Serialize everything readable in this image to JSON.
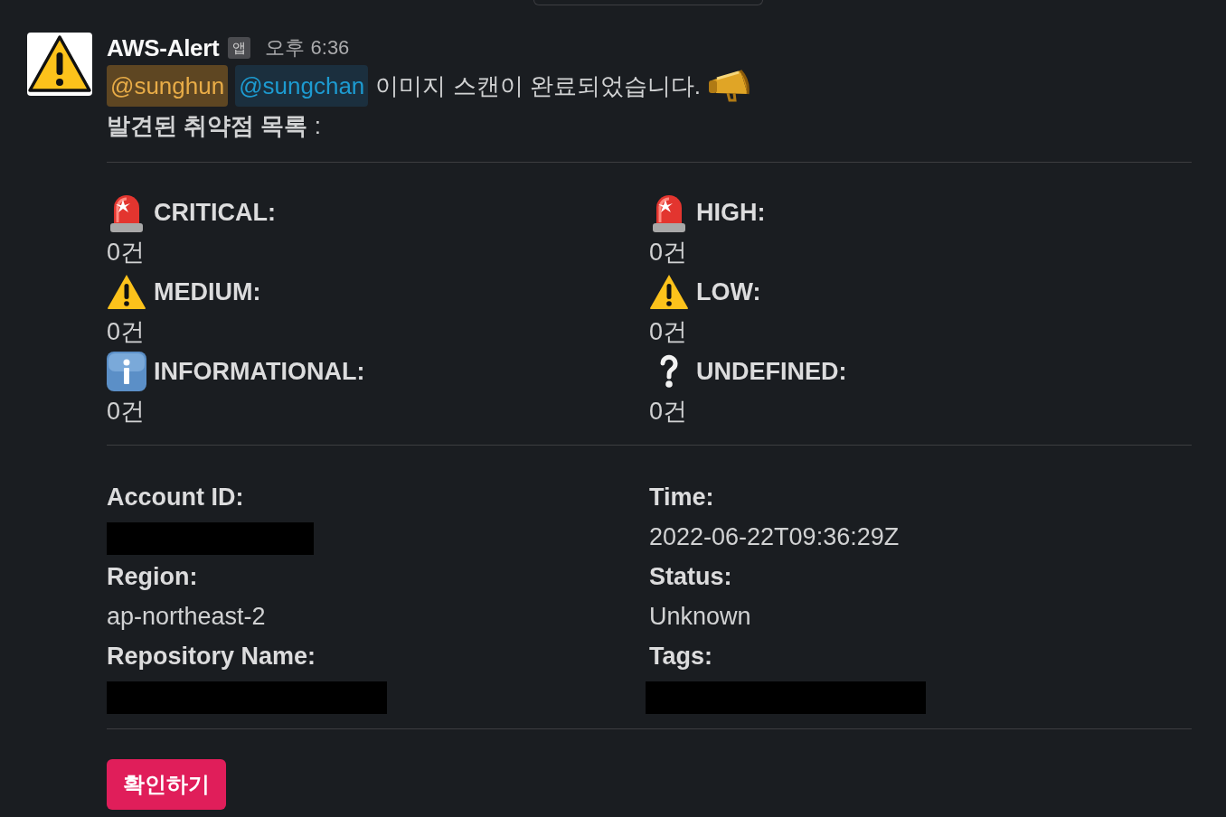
{
  "message": {
    "sender": "AWS-Alert",
    "badge": "앱",
    "time": "오후 6:36",
    "mentions": [
      {
        "text": "@sunghun",
        "highlighted": true
      },
      {
        "text": "@sungchan",
        "highlighted": false
      }
    ],
    "text": "이미지 스캔이 완료되었습니다.",
    "heading": "**발견된 취약점 목록** :"
  },
  "severities": [
    {
      "kind": "alarm",
      "label": "CRITICAL:",
      "count": "0건"
    },
    {
      "kind": "alarm",
      "label": "HIGH:",
      "count": "0건"
    },
    {
      "kind": "warning",
      "label": "MEDIUM:",
      "count": "0건"
    },
    {
      "kind": "warning",
      "label": "LOW:",
      "count": "0건"
    },
    {
      "kind": "info",
      "label": "INFORMATIONAL:",
      "count": "0건"
    },
    {
      "kind": "question",
      "label": "UNDEFINED:",
      "count": "0건"
    }
  ],
  "details": [
    {
      "label": "Account ID:",
      "kind": "redacted"
    },
    {
      "label": "Time:",
      "kind": "text",
      "value": "2022-06-22T09:36:29Z"
    },
    {
      "label": "Region:",
      "kind": "text",
      "value": "ap-northeast-2"
    },
    {
      "label": "Status:",
      "kind": "text",
      "value": "Unknown"
    },
    {
      "label": "Repository Name:",
      "kind": "redacted"
    },
    {
      "label": "Tags:",
      "kind": "redacted"
    }
  ],
  "button": {
    "label": "확인하기"
  }
}
